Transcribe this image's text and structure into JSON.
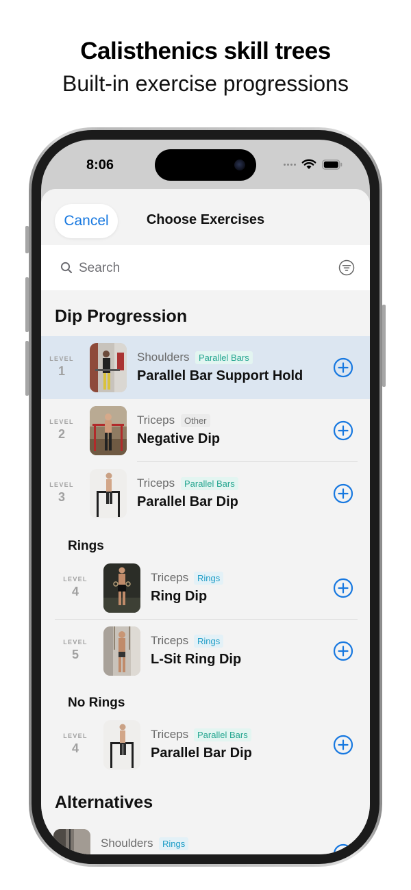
{
  "header": {
    "title": "Calisthenics skill trees",
    "subtitle": "Built-in exercise progressions"
  },
  "status_bar": {
    "time": "8:06"
  },
  "nav": {
    "cancel_label": "Cancel",
    "title": "Choose Exercises"
  },
  "search": {
    "placeholder": "Search"
  },
  "level_label": "LEVEL",
  "sections": {
    "dip": {
      "title": "Dip Progression"
    },
    "rings": {
      "title": "Rings"
    },
    "no_rings": {
      "title": "No Rings"
    },
    "alternatives": {
      "title": "Alternatives"
    }
  },
  "rows": [
    {
      "level": "1",
      "muscle": "Shoulders",
      "tag": "Parallel Bars",
      "name": "Parallel Bar Support Hold",
      "highlighted": true
    },
    {
      "level": "2",
      "muscle": "Triceps",
      "tag": "Other",
      "name": "Negative Dip"
    },
    {
      "level": "3",
      "muscle": "Triceps",
      "tag": "Parallel Bars",
      "name": "Parallel Bar Dip"
    },
    {
      "level": "4",
      "muscle": "Triceps",
      "tag": "Rings",
      "name": "Ring Dip"
    },
    {
      "level": "5",
      "muscle": "Triceps",
      "tag": "Rings",
      "name": "L-Sit Ring Dip"
    },
    {
      "level": "4",
      "muscle": "Triceps",
      "tag": "Parallel Bars",
      "name": "Parallel Bar Dip"
    },
    {
      "muscle": "Shoulders",
      "tag": "Rings"
    }
  ],
  "colors": {
    "accent": "#1778e0",
    "highlight_row": "#dce6f1",
    "tag_parallel_bars": "#23a58f",
    "tag_rings": "#1c9cc6",
    "tag_other": "#6e6e6e"
  },
  "icons": [
    "search-icon",
    "filter-icon",
    "wifi-icon",
    "battery-icon",
    "plus-circle-icon"
  ]
}
